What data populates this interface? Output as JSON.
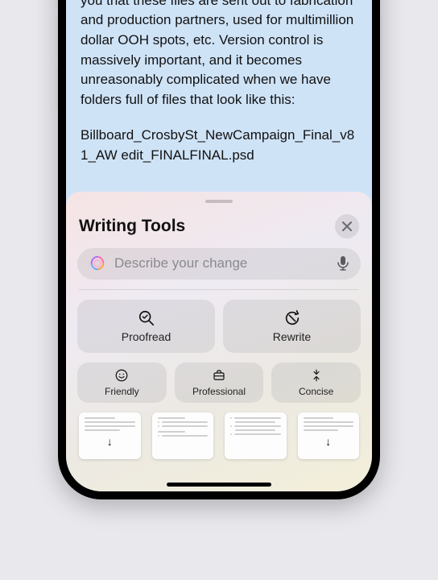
{
  "document": {
    "paragraph1": "kicked off this project. Surely I needn't remind you that these files are sent out to fabrication and production partners, used for multimillion dollar OOH spots, etc. Version control is massively important, and it becomes unreasonably complicated when we have folders full of files that look like this:",
    "paragraph2": "Billboard_CrosbySt_NewCampaign_Final_v81_AW edit_FINALFINAL.psd"
  },
  "sheet": {
    "title": "Writing Tools",
    "search_placeholder": "Describe your change",
    "actions": {
      "proofread": "Proofread",
      "rewrite": "Rewrite",
      "friendly": "Friendly",
      "professional": "Professional",
      "concise": "Concise"
    }
  }
}
